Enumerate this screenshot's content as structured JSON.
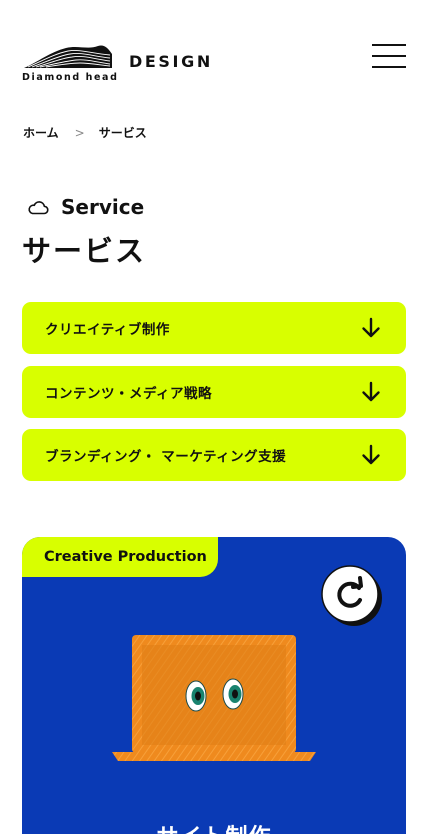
{
  "header": {
    "logo_text": "Diamond head",
    "design_label": "DESIGN",
    "menu_icon": "hamburger-menu-icon"
  },
  "breadcrumb": {
    "home": "ホーム",
    "separator": ">",
    "current": "サービス"
  },
  "heading": {
    "eyebrow_icon": "cloud-icon",
    "eyebrow": "Service",
    "title": "サービス"
  },
  "service_links": [
    {
      "label": "クリエイティブ制作",
      "icon": "arrow-down-icon"
    },
    {
      "label": "コンテンツ・メディア戦略",
      "icon": "arrow-down-icon"
    },
    {
      "label": "ブランディング・ マーケティング支援",
      "icon": "arrow-down-icon"
    }
  ],
  "card": {
    "tag": "Creative Production",
    "refresh_icon": "refresh-icon",
    "illustration": "laptop-with-eyes-illustration",
    "title": "サイト制作"
  },
  "colors": {
    "accent": "#d8ff00",
    "card_bg": "#0a3ab5",
    "text": "#111111",
    "laptop": "#ef8a1e"
  }
}
